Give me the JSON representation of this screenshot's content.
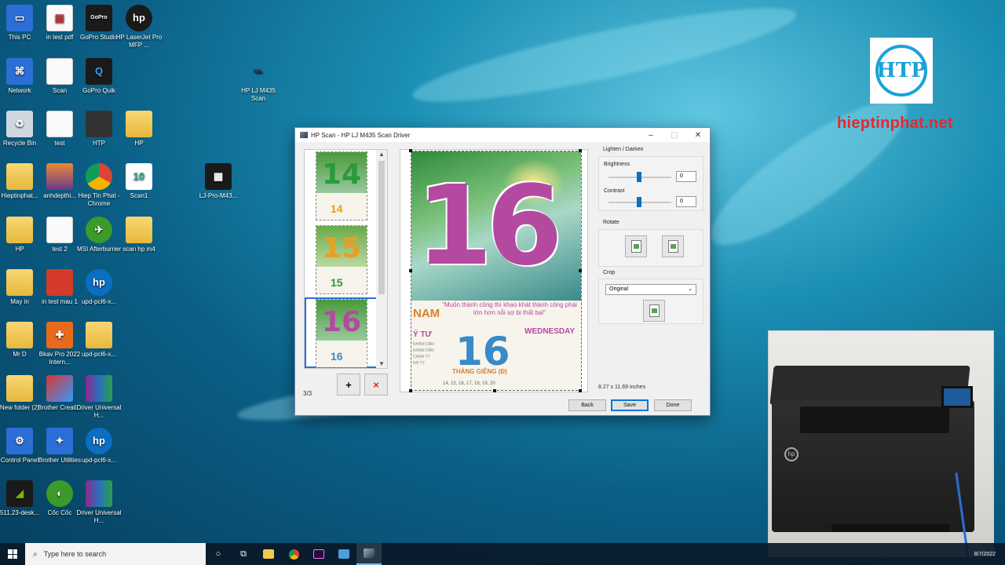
{
  "desktop": {
    "icons": [
      {
        "label": "This PC"
      },
      {
        "label": "in test pdf"
      },
      {
        "label": "GoPro Studio"
      },
      {
        "label": "HP LaserJet Pro MFP ..."
      },
      {
        "label": "Network"
      },
      {
        "label": "Scan"
      },
      {
        "label": "GoPro Quik"
      },
      {
        "label": "Recycle Bin"
      },
      {
        "label": "test"
      },
      {
        "label": "HTP"
      },
      {
        "label": "HP"
      },
      {
        "label": "Hieptinphat..."
      },
      {
        "label": "anhdepthi..."
      },
      {
        "label": "Hiep Tin Phat - Chrome"
      },
      {
        "label": "Scan1"
      },
      {
        "label": "HP"
      },
      {
        "label": "test 2"
      },
      {
        "label": "MSI Afterburner"
      },
      {
        "label": "scan hp m4"
      },
      {
        "label": "May in"
      },
      {
        "label": "in test mau 1"
      },
      {
        "label": "upd-pcl6-x..."
      },
      {
        "label": "Mr D"
      },
      {
        "label": "Bkav Pro 2022 Intern..."
      },
      {
        "label": "upd-pcl6-x..."
      },
      {
        "label": "New folder (2)"
      },
      {
        "label": "Brother Creati..."
      },
      {
        "label": "Driver Universal H..."
      },
      {
        "label": "Control Panel"
      },
      {
        "label": "Brother Utilities"
      },
      {
        "label": "upd-pcl6-x..."
      },
      {
        "label": "511.23-desk..."
      },
      {
        "label": "Cốc Cốc"
      },
      {
        "label": "Driver Universal H..."
      },
      {
        "label": "HP LJ M435 Scan"
      },
      {
        "label": "LJ-Pro-M43..."
      }
    ]
  },
  "watermark": {
    "logo_letters": "HTP",
    "site": "hieptinphat.net"
  },
  "scan_window": {
    "title": "HP Scan - HP LJ M435 Scan Driver",
    "thumbnails": [
      {
        "big": "14",
        "small": "14",
        "color": "#2a9a3a"
      },
      {
        "big": "15",
        "small": "15",
        "color": "#e8a020"
      },
      {
        "big": "16",
        "small": "16",
        "color": "#b34aa0"
      }
    ],
    "page_count": "3/3",
    "add_label": "+",
    "delete_label": "×",
    "preview": {
      "big_number": "16",
      "quote": "\"Muốn thành công thì khao khát thành công phải lớn hơn nỗi sợ bị thất bại\"",
      "nam": "NAM",
      "tu": "Ý TƯ",
      "lines": [
        "NHÂM DẦN",
        "NHÂM DẦN",
        "CANH TÝ",
        "NH TỴ"
      ],
      "mid_number": "16",
      "weekday": "WEDNESDAY",
      "lunar": "THÁNG GIÊNG (Đ)",
      "dates": "14, 15, 16, 17, 18, 19, 20"
    },
    "lighten_darken_label": "Lighten / Darken",
    "brightness_label": "Brightness",
    "brightness_value": "0",
    "contrast_label": "Contrast",
    "contrast_value": "0",
    "rotate_label": "Rotate",
    "crop_label": "Crop",
    "crop_option": "Original",
    "dimensions": "8.27 x 11.69 inches",
    "buttons": {
      "back": "Back",
      "save": "Save",
      "done": "Done"
    }
  },
  "taskbar": {
    "search_placeholder": "Type here to search",
    "date": "8/7/2022"
  }
}
